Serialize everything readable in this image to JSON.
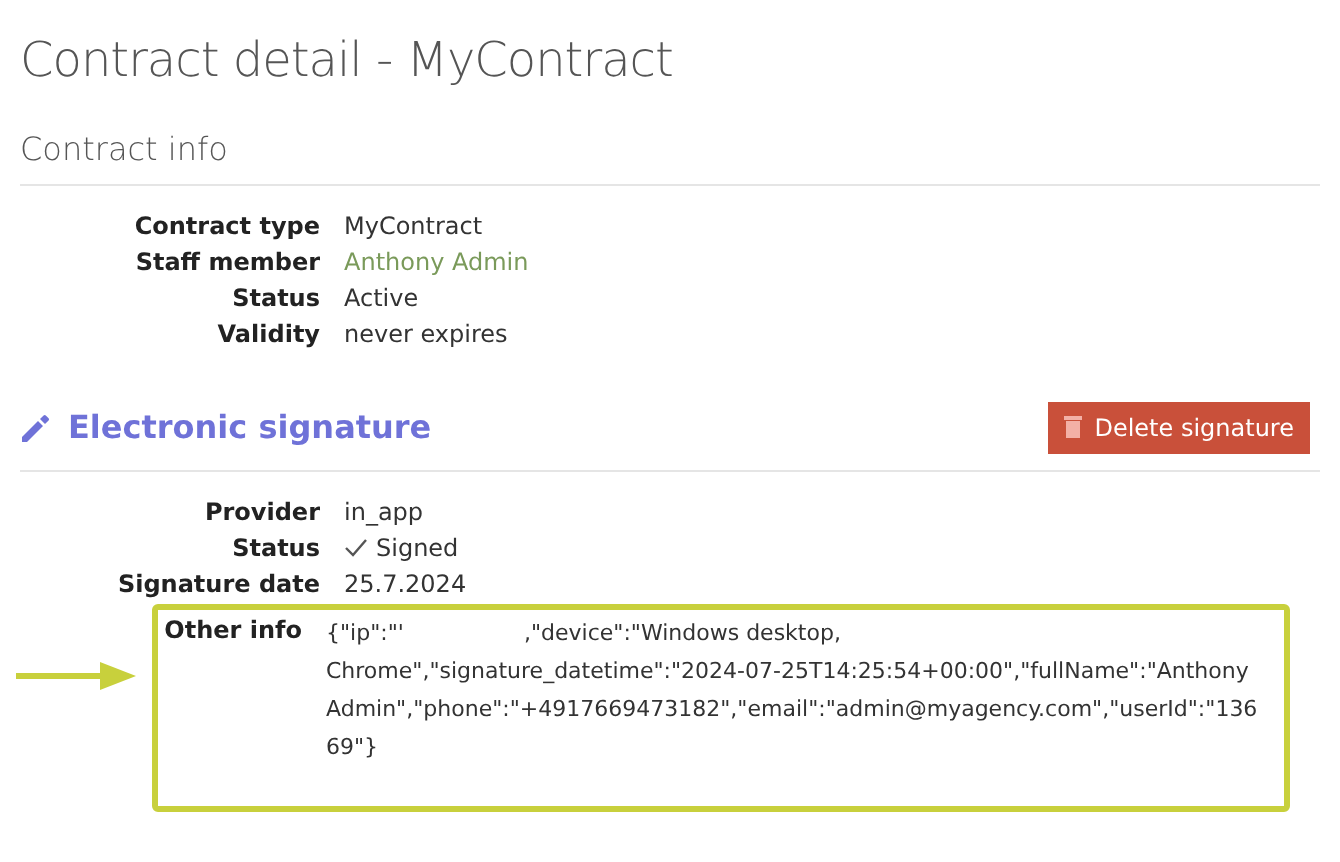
{
  "title": "Contract detail - MyContract",
  "contract_info": {
    "heading": "Contract info",
    "fields": [
      {
        "label": "Contract type",
        "value": "MyContract",
        "kind": "text"
      },
      {
        "label": "Staff member",
        "value": "Anthony Admin",
        "kind": "link"
      },
      {
        "label": "Status",
        "value": "Active",
        "kind": "text"
      },
      {
        "label": "Validity",
        "value": "never expires",
        "kind": "text"
      }
    ]
  },
  "signature": {
    "heading": "Electronic signature",
    "delete_button": "Delete signature",
    "fields": [
      {
        "label": "Provider",
        "value": "in_app",
        "kind": "text"
      },
      {
        "label": "Status",
        "value": "Signed",
        "kind": "check"
      },
      {
        "label": "Signature date",
        "value": "25.7.2024",
        "kind": "text"
      }
    ],
    "other_info": {
      "label": "Other info",
      "value_start": "{\"ip\":\"'",
      "value_rest": ",\"device\":\"Windows desktop, Chrome\",\"signature_datetime\":\"2024-07-25T14:25:54+00:00\",\"fullName\":\"Anthony Admin\",\"phone\":\"+4917669473182\",\"email\":\"admin@myagency.com\",\"userId\":\"13669\"}",
      "highlighted": true
    }
  }
}
